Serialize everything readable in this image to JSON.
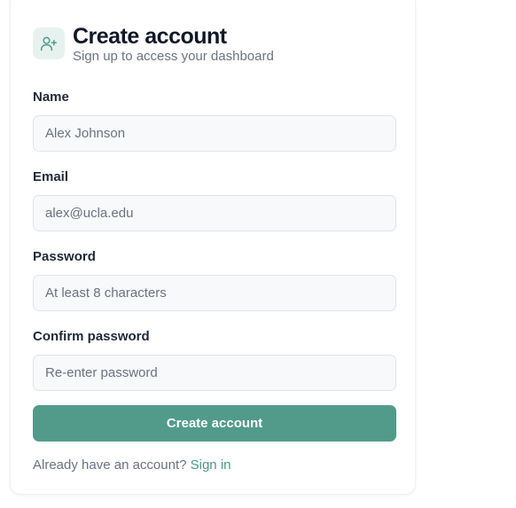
{
  "header": {
    "icon": "user-plus-icon",
    "title": "Create account",
    "subtitle": "Sign up to access your dashboard"
  },
  "form": {
    "name": {
      "label": "Name",
      "placeholder": "Alex Johnson",
      "value": ""
    },
    "email": {
      "label": "Email",
      "placeholder": "alex@ucla.edu",
      "value": ""
    },
    "password": {
      "label": "Password",
      "placeholder": "At least 8 characters",
      "value": ""
    },
    "confirm": {
      "label": "Confirm password",
      "placeholder": "Re-enter password",
      "value": ""
    },
    "submit_label": "Create account"
  },
  "footer": {
    "prompt": "Already have an account?",
    "link_label": "Sign in"
  },
  "colors": {
    "accent": "#529b8b",
    "icon_bg": "#e7f2ef",
    "input_bg": "#f8f9fb"
  }
}
